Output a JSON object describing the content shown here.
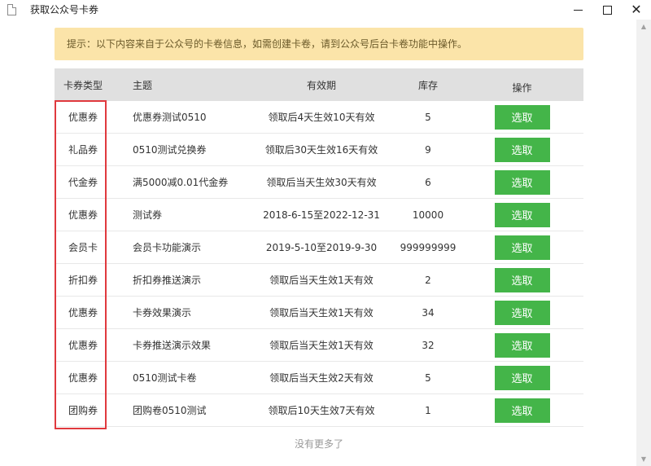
{
  "window": {
    "title": "获取公众号卡券",
    "icons": {
      "document": "document-icon",
      "minimize": "minimize-icon",
      "maximize": "maximize-icon",
      "close": "close-icon"
    },
    "close_glyph": "✕"
  },
  "notice": "提示：以下内容来自于公众号的卡卷信息，如需创建卡卷，请到公众号后台卡卷功能中操作。",
  "table": {
    "headers": {
      "type": "卡券类型",
      "subject": "主题",
      "validity": "有效期",
      "stock": "库存",
      "action": "操作"
    },
    "rows": [
      {
        "type": "优惠券",
        "subject": "优惠券测试0510",
        "validity": "领取后4天生效10天有效",
        "stock": "5",
        "action": "选取"
      },
      {
        "type": "礼品券",
        "subject": "0510测试兑换券",
        "validity": "领取后30天生效16天有效",
        "stock": "9",
        "action": "选取"
      },
      {
        "type": "代金券",
        "subject": "满5000减0.01代金券",
        "validity": "领取后当天生效30天有效",
        "stock": "6",
        "action": "选取"
      },
      {
        "type": "优惠券",
        "subject": "测试券",
        "validity": "2018-6-15至2022-12-31",
        "stock": "10000",
        "action": "选取"
      },
      {
        "type": "会员卡",
        "subject": "会员卡功能演示",
        "validity": "2019-5-10至2019-9-30",
        "stock": "999999999",
        "action": "选取"
      },
      {
        "type": "折扣券",
        "subject": "折扣券推送演示",
        "validity": "领取后当天生效1天有效",
        "stock": "2",
        "action": "选取"
      },
      {
        "type": "优惠券",
        "subject": "卡券效果演示",
        "validity": "领取后当天生效1天有效",
        "stock": "34",
        "action": "选取"
      },
      {
        "type": "优惠券",
        "subject": "卡券推送演示效果",
        "validity": "领取后当天生效1天有效",
        "stock": "32",
        "action": "选取"
      },
      {
        "type": "优惠券",
        "subject": "0510测试卡卷",
        "validity": "领取后当天生效2天有效",
        "stock": "5",
        "action": "选取"
      },
      {
        "type": "团购券",
        "subject": "团购卷0510测试",
        "validity": "领取后10天生效7天有效",
        "stock": "1",
        "action": "选取"
      }
    ]
  },
  "footer": "没有更多了",
  "colors": {
    "notice_bg": "#fbe4a9",
    "header_bg": "#e0e0e0",
    "button_green": "#44b549",
    "highlight_red": "#e0393e"
  }
}
